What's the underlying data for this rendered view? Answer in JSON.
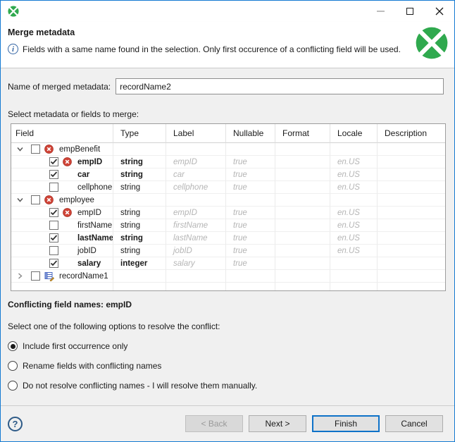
{
  "window": {
    "controls": {
      "minimize": "minimize",
      "maximize": "maximize",
      "close": "close"
    }
  },
  "header": {
    "title": "Merge metadata",
    "info": "Fields with a same name found in the selection. Only first occurence of a conflicting field will be used."
  },
  "form": {
    "name_label": "Name of merged metadata:",
    "name_value": "recordName2",
    "select_label": "Select metadata or fields to merge:"
  },
  "table": {
    "columns": [
      "Field",
      "Type",
      "Label",
      "Nullable",
      "Format",
      "Locale",
      "Description"
    ],
    "rows": [
      {
        "kind": "group",
        "expanded": true,
        "checked": false,
        "icon": "error",
        "name": "empBenefit"
      },
      {
        "kind": "field",
        "checked": true,
        "icon": "error",
        "bold": true,
        "name": "empID",
        "type": "string",
        "label": "empID",
        "nullable": "true",
        "format": "",
        "locale": "en.US",
        "description": ""
      },
      {
        "kind": "field",
        "checked": true,
        "icon": null,
        "bold": true,
        "name": "car",
        "type": "string",
        "label": "car",
        "nullable": "true",
        "format": "",
        "locale": "en.US",
        "description": ""
      },
      {
        "kind": "field",
        "checked": false,
        "icon": null,
        "bold": false,
        "name": "cellphone",
        "type": "string",
        "label": "cellphone",
        "nullable": "true",
        "format": "",
        "locale": "en.US",
        "description": ""
      },
      {
        "kind": "group",
        "expanded": true,
        "checked": false,
        "icon": "error",
        "name": "employee"
      },
      {
        "kind": "field",
        "checked": true,
        "icon": "error",
        "bold": false,
        "name": "empID",
        "type": "string",
        "label": "empID",
        "nullable": "true",
        "format": "",
        "locale": "en.US",
        "description": ""
      },
      {
        "kind": "field",
        "checked": false,
        "icon": null,
        "bold": false,
        "name": "firstName",
        "type": "string",
        "label": "firstName",
        "nullable": "true",
        "format": "",
        "locale": "en.US",
        "description": ""
      },
      {
        "kind": "field",
        "checked": true,
        "icon": null,
        "bold": true,
        "name": "lastName",
        "type": "string",
        "label": "lastName",
        "nullable": "true",
        "format": "",
        "locale": "en.US",
        "description": ""
      },
      {
        "kind": "field",
        "checked": false,
        "icon": null,
        "bold": false,
        "name": "jobID",
        "type": "string",
        "label": "jobID",
        "nullable": "true",
        "format": "",
        "locale": "en.US",
        "description": ""
      },
      {
        "kind": "field",
        "checked": true,
        "icon": null,
        "bold": true,
        "name": "salary",
        "type": "integer",
        "label": "salary",
        "nullable": "true",
        "format": "",
        "locale": "",
        "description": ""
      },
      {
        "kind": "group",
        "expanded": false,
        "checked": false,
        "icon": "metadata",
        "name": "recordName1"
      }
    ]
  },
  "conflict": {
    "title": "Conflicting field names: empID",
    "prompt": "Select one of the following options to resolve the conflict:",
    "options": [
      {
        "label": "Include first occurrence only",
        "selected": true
      },
      {
        "label": "Rename fields with conflicting names",
        "selected": false
      },
      {
        "label": "Do not resolve conflicting names - I will resolve them manually.",
        "selected": false
      }
    ]
  },
  "footer": {
    "help": "?",
    "buttons": [
      {
        "label": "< Back",
        "enabled": false,
        "default": false
      },
      {
        "label": "Next >",
        "enabled": true,
        "default": false
      },
      {
        "label": "Finish",
        "enabled": true,
        "default": true
      },
      {
        "label": "Cancel",
        "enabled": true,
        "default": false
      }
    ]
  },
  "colors": {
    "accent_border": "#147ad2",
    "clover_green": "#2fa94e",
    "error_red": "#cf4336",
    "default_button_border": "#0e72c8"
  }
}
